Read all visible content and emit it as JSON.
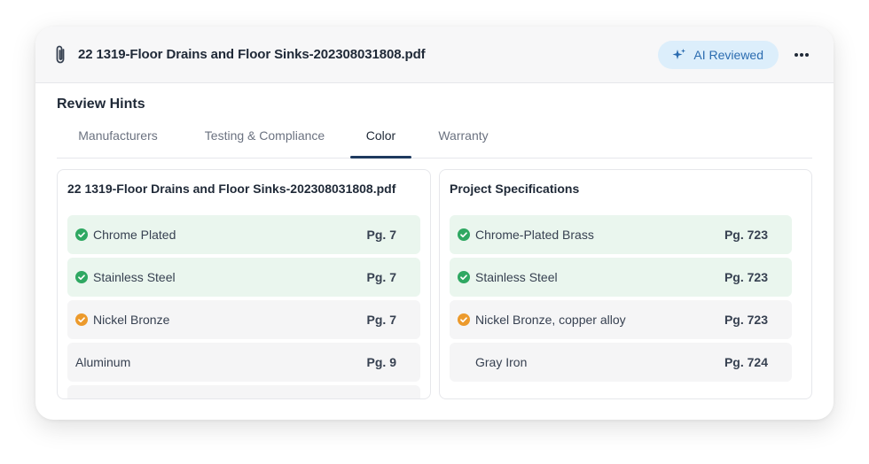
{
  "header": {
    "file_name": "22 1319-Floor Drains and Floor Sinks-202308031808.pdf",
    "ai_badge_label": "AI Reviewed"
  },
  "section_title": "Review Hints",
  "tabs": [
    {
      "label": "Manufacturers",
      "active": false
    },
    {
      "label": "Testing & Compliance",
      "active": false
    },
    {
      "label": "Color",
      "active": true
    },
    {
      "label": "Warranty",
      "active": false
    }
  ],
  "left_panel": {
    "title": "22 1319-Floor Drains and Floor Sinks-202308031808.pdf",
    "rows": [
      {
        "label": "Chrome Plated",
        "page": "Pg. 7",
        "status": "match"
      },
      {
        "label": "Stainless Steel",
        "page": "Pg. 7",
        "status": "match"
      },
      {
        "label": "Nickel Bronze",
        "page": "Pg. 7",
        "status": "partial"
      },
      {
        "label": "Aluminum",
        "page": "Pg. 9",
        "status": "none"
      }
    ]
  },
  "right_panel": {
    "title": "Project Specifications",
    "rows": [
      {
        "label": "Chrome-Plated Brass",
        "page": "Pg. 723",
        "status": "match"
      },
      {
        "label": "Stainless Steel",
        "page": "Pg. 723",
        "status": "match"
      },
      {
        "label": "Nickel Bronze, copper alloy",
        "page": "Pg. 723",
        "status": "partial"
      },
      {
        "label": "Gray Iron",
        "page": "Pg. 724",
        "status": "none"
      }
    ]
  },
  "colors": {
    "match_green": "#2fa862",
    "partial_orange": "#ec9a2c",
    "badge_blue": "#2b6cb0",
    "tab_active": "#1e3a5f"
  }
}
